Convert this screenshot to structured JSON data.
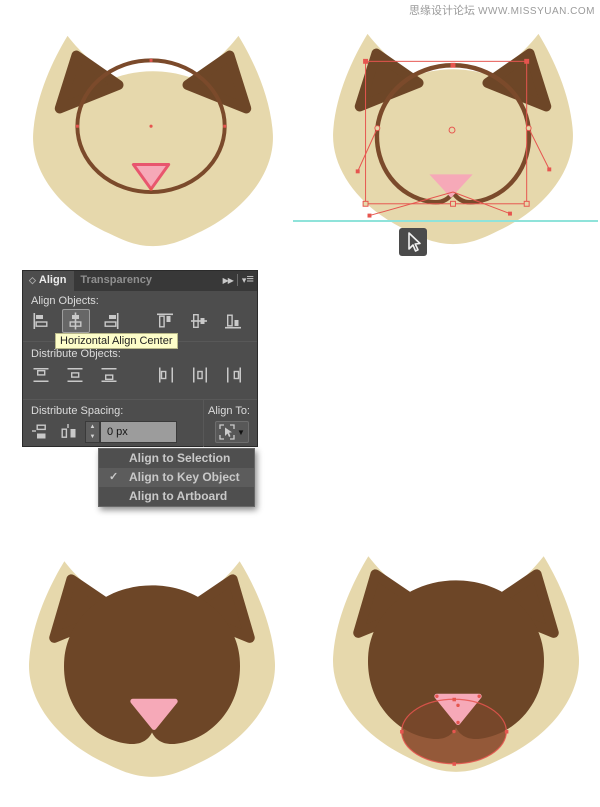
{
  "watermark": {
    "site_name": "思缘设计论坛",
    "site_url": "WWW.MISSYUAN.COM"
  },
  "palette": {
    "page_bg": "#ffffff",
    "cat_cream": "#e6d8ac",
    "cat_brown": "#6d4627",
    "outline_brown": "#7b4a2b",
    "chin_brown": "#8d5a38",
    "nose_pink": "#f6a9b8",
    "nose_stroke": "#e8566e",
    "selection_red": "#e6554f",
    "guide_cyan": "#8fe3da",
    "panel_bg": "#4d4d4d",
    "tabbar_bg": "#383838",
    "panel_text": "#dcdcdc",
    "icon_gray": "#c9c9c9",
    "tooltip_bg": "#fdfdc9",
    "tooltip_text": "#222222",
    "field_bg": "#9c9c9c",
    "menu_bg": "#4f4f4f",
    "menu_text": "#c9c9c9"
  },
  "glyphs": {
    "tab_diamond": "◇",
    "collapse_arrows": "▶▶",
    "menu_triangle": "▾",
    "menu_lines": "≡",
    "check": "✓",
    "dropdown_arrow": "▼",
    "stepper_up": "▲",
    "stepper_down": "▼"
  },
  "align_panel": {
    "tabs": [
      {
        "label": "Align"
      },
      {
        "label": "Transparency"
      }
    ],
    "align_objects_label": "Align Objects:",
    "distribute_objects_label": "Distribute Objects:",
    "distribute_spacing_label": "Distribute Spacing:",
    "align_to_label": "Align To:",
    "spacing_value": "0 px",
    "tooltip": "Horizontal Align Center",
    "align_buttons": [
      "horizontal-align-left",
      "horizontal-align-center",
      "horizontal-align-right",
      "vertical-align-top",
      "vertical-align-center",
      "vertical-align-bottom"
    ],
    "active_align_button": "horizontal-align-center",
    "distribute_buttons": [
      "vertical-distribute-top",
      "vertical-distribute-center",
      "vertical-distribute-bottom",
      "horizontal-distribute-left",
      "horizontal-distribute-center",
      "horizontal-distribute-right"
    ],
    "spacing_buttons": [
      "vertical-distribute-space",
      "horizontal-distribute-space"
    ],
    "align_to_button": "align-to-dropdown"
  },
  "align_to_menu": {
    "items": [
      {
        "label": "Align to Selection",
        "checked": false
      },
      {
        "label": "Align to Key Object",
        "checked": true
      },
      {
        "label": "Align to Artboard",
        "checked": false
      }
    ]
  },
  "canvas": {
    "steps": [
      "stroked-circle-guide",
      "muzzle-path-selected",
      "muzzle-filled",
      "chin-ellipse-selected"
    ]
  }
}
